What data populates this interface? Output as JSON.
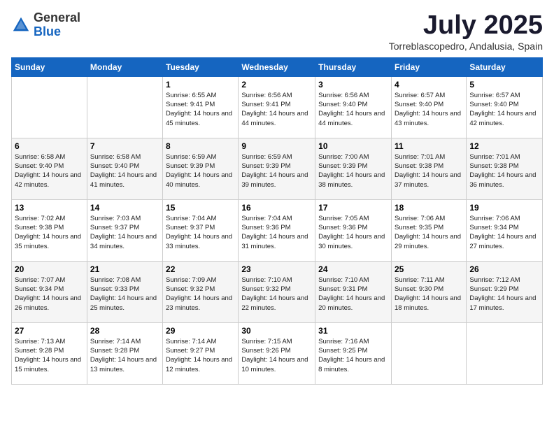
{
  "header": {
    "logo_general": "General",
    "logo_blue": "Blue",
    "month_title": "July 2025",
    "location": "Torreblascopedro, Andalusia, Spain"
  },
  "days_of_week": [
    "Sunday",
    "Monday",
    "Tuesday",
    "Wednesday",
    "Thursday",
    "Friday",
    "Saturday"
  ],
  "weeks": [
    [
      {
        "day": "",
        "sunrise": "",
        "sunset": "",
        "daylight": ""
      },
      {
        "day": "",
        "sunrise": "",
        "sunset": "",
        "daylight": ""
      },
      {
        "day": "1",
        "sunrise": "Sunrise: 6:55 AM",
        "sunset": "Sunset: 9:41 PM",
        "daylight": "Daylight: 14 hours and 45 minutes."
      },
      {
        "day": "2",
        "sunrise": "Sunrise: 6:56 AM",
        "sunset": "Sunset: 9:41 PM",
        "daylight": "Daylight: 14 hours and 44 minutes."
      },
      {
        "day": "3",
        "sunrise": "Sunrise: 6:56 AM",
        "sunset": "Sunset: 9:40 PM",
        "daylight": "Daylight: 14 hours and 44 minutes."
      },
      {
        "day": "4",
        "sunrise": "Sunrise: 6:57 AM",
        "sunset": "Sunset: 9:40 PM",
        "daylight": "Daylight: 14 hours and 43 minutes."
      },
      {
        "day": "5",
        "sunrise": "Sunrise: 6:57 AM",
        "sunset": "Sunset: 9:40 PM",
        "daylight": "Daylight: 14 hours and 42 minutes."
      }
    ],
    [
      {
        "day": "6",
        "sunrise": "Sunrise: 6:58 AM",
        "sunset": "Sunset: 9:40 PM",
        "daylight": "Daylight: 14 hours and 42 minutes."
      },
      {
        "day": "7",
        "sunrise": "Sunrise: 6:58 AM",
        "sunset": "Sunset: 9:40 PM",
        "daylight": "Daylight: 14 hours and 41 minutes."
      },
      {
        "day": "8",
        "sunrise": "Sunrise: 6:59 AM",
        "sunset": "Sunset: 9:39 PM",
        "daylight": "Daylight: 14 hours and 40 minutes."
      },
      {
        "day": "9",
        "sunrise": "Sunrise: 6:59 AM",
        "sunset": "Sunset: 9:39 PM",
        "daylight": "Daylight: 14 hours and 39 minutes."
      },
      {
        "day": "10",
        "sunrise": "Sunrise: 7:00 AM",
        "sunset": "Sunset: 9:39 PM",
        "daylight": "Daylight: 14 hours and 38 minutes."
      },
      {
        "day": "11",
        "sunrise": "Sunrise: 7:01 AM",
        "sunset": "Sunset: 9:38 PM",
        "daylight": "Daylight: 14 hours and 37 minutes."
      },
      {
        "day": "12",
        "sunrise": "Sunrise: 7:01 AM",
        "sunset": "Sunset: 9:38 PM",
        "daylight": "Daylight: 14 hours and 36 minutes."
      }
    ],
    [
      {
        "day": "13",
        "sunrise": "Sunrise: 7:02 AM",
        "sunset": "Sunset: 9:38 PM",
        "daylight": "Daylight: 14 hours and 35 minutes."
      },
      {
        "day": "14",
        "sunrise": "Sunrise: 7:03 AM",
        "sunset": "Sunset: 9:37 PM",
        "daylight": "Daylight: 14 hours and 34 minutes."
      },
      {
        "day": "15",
        "sunrise": "Sunrise: 7:04 AM",
        "sunset": "Sunset: 9:37 PM",
        "daylight": "Daylight: 14 hours and 33 minutes."
      },
      {
        "day": "16",
        "sunrise": "Sunrise: 7:04 AM",
        "sunset": "Sunset: 9:36 PM",
        "daylight": "Daylight: 14 hours and 31 minutes."
      },
      {
        "day": "17",
        "sunrise": "Sunrise: 7:05 AM",
        "sunset": "Sunset: 9:36 PM",
        "daylight": "Daylight: 14 hours and 30 minutes."
      },
      {
        "day": "18",
        "sunrise": "Sunrise: 7:06 AM",
        "sunset": "Sunset: 9:35 PM",
        "daylight": "Daylight: 14 hours and 29 minutes."
      },
      {
        "day": "19",
        "sunrise": "Sunrise: 7:06 AM",
        "sunset": "Sunset: 9:34 PM",
        "daylight": "Daylight: 14 hours and 27 minutes."
      }
    ],
    [
      {
        "day": "20",
        "sunrise": "Sunrise: 7:07 AM",
        "sunset": "Sunset: 9:34 PM",
        "daylight": "Daylight: 14 hours and 26 minutes."
      },
      {
        "day": "21",
        "sunrise": "Sunrise: 7:08 AM",
        "sunset": "Sunset: 9:33 PM",
        "daylight": "Daylight: 14 hours and 25 minutes."
      },
      {
        "day": "22",
        "sunrise": "Sunrise: 7:09 AM",
        "sunset": "Sunset: 9:32 PM",
        "daylight": "Daylight: 14 hours and 23 minutes."
      },
      {
        "day": "23",
        "sunrise": "Sunrise: 7:10 AM",
        "sunset": "Sunset: 9:32 PM",
        "daylight": "Daylight: 14 hours and 22 minutes."
      },
      {
        "day": "24",
        "sunrise": "Sunrise: 7:10 AM",
        "sunset": "Sunset: 9:31 PM",
        "daylight": "Daylight: 14 hours and 20 minutes."
      },
      {
        "day": "25",
        "sunrise": "Sunrise: 7:11 AM",
        "sunset": "Sunset: 9:30 PM",
        "daylight": "Daylight: 14 hours and 18 minutes."
      },
      {
        "day": "26",
        "sunrise": "Sunrise: 7:12 AM",
        "sunset": "Sunset: 9:29 PM",
        "daylight": "Daylight: 14 hours and 17 minutes."
      }
    ],
    [
      {
        "day": "27",
        "sunrise": "Sunrise: 7:13 AM",
        "sunset": "Sunset: 9:28 PM",
        "daylight": "Daylight: 14 hours and 15 minutes."
      },
      {
        "day": "28",
        "sunrise": "Sunrise: 7:14 AM",
        "sunset": "Sunset: 9:28 PM",
        "daylight": "Daylight: 14 hours and 13 minutes."
      },
      {
        "day": "29",
        "sunrise": "Sunrise: 7:14 AM",
        "sunset": "Sunset: 9:27 PM",
        "daylight": "Daylight: 14 hours and 12 minutes."
      },
      {
        "day": "30",
        "sunrise": "Sunrise: 7:15 AM",
        "sunset": "Sunset: 9:26 PM",
        "daylight": "Daylight: 14 hours and 10 minutes."
      },
      {
        "day": "31",
        "sunrise": "Sunrise: 7:16 AM",
        "sunset": "Sunset: 9:25 PM",
        "daylight": "Daylight: 14 hours and 8 minutes."
      },
      {
        "day": "",
        "sunrise": "",
        "sunset": "",
        "daylight": ""
      },
      {
        "day": "",
        "sunrise": "",
        "sunset": "",
        "daylight": ""
      }
    ]
  ]
}
